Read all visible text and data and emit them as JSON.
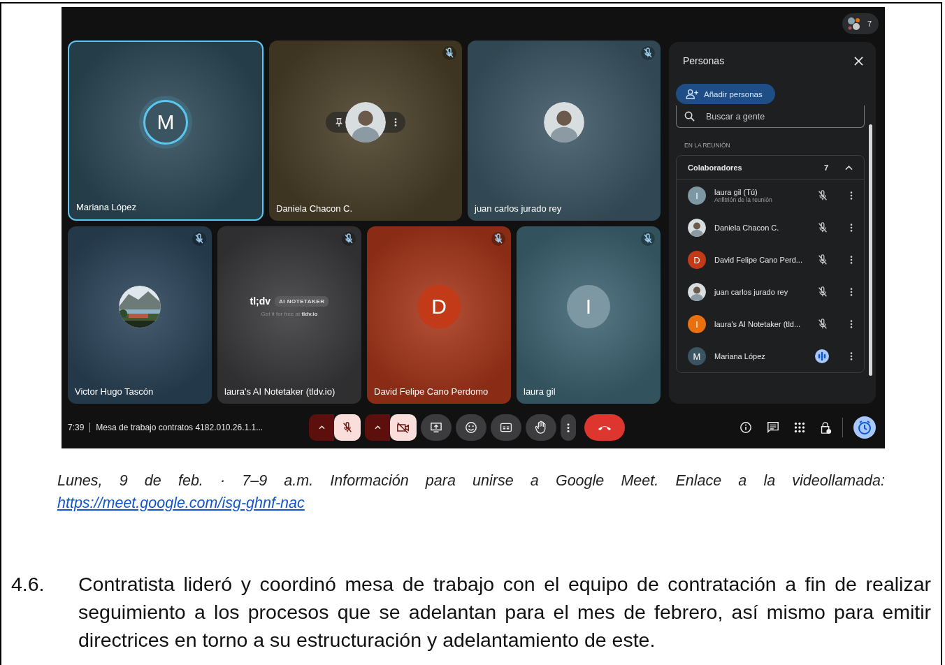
{
  "meeting": {
    "participant_count": "7",
    "tiles": [
      {
        "name": "Mariana López",
        "speaking": true,
        "muted": false,
        "color": "#2d4a58",
        "avatar": {
          "kind": "initial",
          "letter": "M",
          "color": "#3a5561"
        }
      },
      {
        "name": "Daniela Chacon C.",
        "speaking": false,
        "muted": true,
        "color": "#4a3f28",
        "hover_actions": true,
        "avatar": {
          "kind": "person"
        }
      },
      {
        "name": "juan carlos jurado rey",
        "speaking": false,
        "muted": true,
        "color": "#3c5765",
        "avatar": {
          "kind": "person"
        }
      },
      {
        "name": "Victor Hugo Tascón",
        "speaking": false,
        "muted": true,
        "color": "#2b4459"
      },
      {
        "name": "laura's AI Notetaker (tldv.io)",
        "speaking": false,
        "muted": true,
        "color": "#39393b",
        "avatar": {
          "kind": "logo",
          "name": "tl;dv",
          "badge": "AI NOTETAKER",
          "tagline": "Get it for free at **tldv.io**"
        }
      },
      {
        "name": "David Felipe Cano Perdomo",
        "speaking": false,
        "muted": true,
        "color": "#a8361a",
        "avatar": {
          "kind": "initial",
          "letter": "D",
          "color": "#c23a18"
        }
      },
      {
        "name": "laura gil",
        "speaking": false,
        "muted": true,
        "color": "#3d6472",
        "avatar": {
          "kind": "initial",
          "letter": "I",
          "color": "#7d98a2"
        }
      }
    ],
    "panel": {
      "title": "Personas",
      "add_button": "Añadir personas",
      "search_placeholder": "Buscar a gente",
      "section_label": "EN LA REUNIÓN",
      "group": {
        "label": "Colaboradores",
        "count": "7",
        "expanded": true
      },
      "people": [
        {
          "name": "laura gil (Tú)",
          "subtitle": "Anfitrión de la reunión",
          "muted": true,
          "avatar": {
            "kind": "initial",
            "letter": "I",
            "color": "#7d98a2"
          }
        },
        {
          "name": "Daniela Chacon C.",
          "muted": true,
          "avatar": {
            "kind": "person"
          }
        },
        {
          "name": "David Felipe Cano Perd...",
          "muted": true,
          "avatar": {
            "kind": "initial",
            "letter": "D",
            "color": "#c23a18"
          }
        },
        {
          "name": "juan carlos jurado rey",
          "muted": true,
          "avatar": {
            "kind": "person"
          }
        },
        {
          "name": "laura's AI Notetaker (tld...",
          "muted": true,
          "avatar": {
            "kind": "initial",
            "letter": "I",
            "color": "#e8700f"
          }
        },
        {
          "name": "Mariana López",
          "muted": false,
          "speaking": true,
          "avatar": {
            "kind": "initial",
            "letter": "M",
            "color": "#3a5561"
          }
        }
      ]
    },
    "bottom_bar": {
      "time": "7:39",
      "title": "Mesa de trabajo contratos 4182.010.26.1.1...",
      "mic_on": false,
      "camera_on": false
    }
  },
  "caption": {
    "text": "Lunes, 9 de feb. · 7–9 a.m. Información para unirse a Google Meet. Enlace a la videollamada: ",
    "link": "https://meet.google.com/isg-ghnf-nac"
  },
  "item": {
    "number": "4.6.",
    "text": "Contratista lideró y coordinó mesa de trabajo con el equipo de contratación a fin de realizar seguimiento a los procesos que se adelantan para el mes de febrero, así mismo para emitir directrices en torno a su estructuración y adelantamiento de este."
  }
}
